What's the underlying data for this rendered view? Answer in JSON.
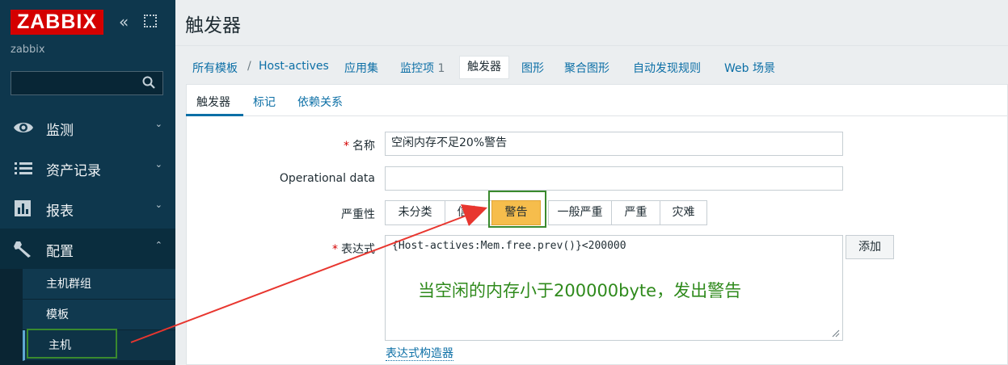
{
  "sidebar": {
    "logo": "ZABBIX",
    "collapse_glyph": "«",
    "server_name": "zabbix",
    "search_placeholder": "",
    "menu": [
      {
        "label": "监测",
        "icon": "eye-icon",
        "chevron": "⌄"
      },
      {
        "label": "资产记录",
        "icon": "list-icon",
        "chevron": "⌄"
      },
      {
        "label": "报表",
        "icon": "bar-chart-icon",
        "chevron": "⌄"
      },
      {
        "label": "配置",
        "icon": "wrench-icon",
        "chevron": "⌃"
      }
    ],
    "submenu": [
      {
        "label": "主机群组"
      },
      {
        "label": "模板"
      },
      {
        "label": "主机"
      }
    ]
  },
  "page": {
    "title": "触发器"
  },
  "breadcrumb": {
    "all_templates": "所有模板",
    "separator": "/",
    "host": "Host-actives",
    "applications": "应用集",
    "items": "监控项",
    "items_count": "1",
    "triggers": "触发器",
    "graphs": "图形",
    "screens": "聚合图形",
    "discovery": "自动发现规则",
    "web": "Web 场景"
  },
  "tabs": [
    {
      "label": "触发器"
    },
    {
      "label": "标记"
    },
    {
      "label": "依赖关系"
    }
  ],
  "form": {
    "required_mark": "*",
    "name_label": "名称",
    "name_value": "空闲内存不足20%警告",
    "opdata_label": "Operational data",
    "opdata_value": "",
    "severity_label": "严重性",
    "severities": [
      {
        "label": "未分类"
      },
      {
        "label": "信息"
      },
      {
        "label": "警告"
      },
      {
        "label": "一般严重"
      },
      {
        "label": "严重"
      },
      {
        "label": "灾难"
      }
    ],
    "selected_severity": "警告",
    "expression_label": "表达式",
    "expression_value": "{Host-actives:Mem.free.prev()}<200000",
    "add_button": "添加",
    "expression_builder": "表达式构造器"
  },
  "annotation": {
    "note": "当空闲的内存小于200000byte，发出警告",
    "color": "#2f8a1c",
    "arrow_color": "#e8362f",
    "box_color": "#3a8a2e"
  },
  "colors": {
    "sidebar_bg": "#0e374d",
    "logo_bg": "#d40000",
    "link": "#0c6fa6",
    "severity_warning": "#f6bd4c"
  }
}
